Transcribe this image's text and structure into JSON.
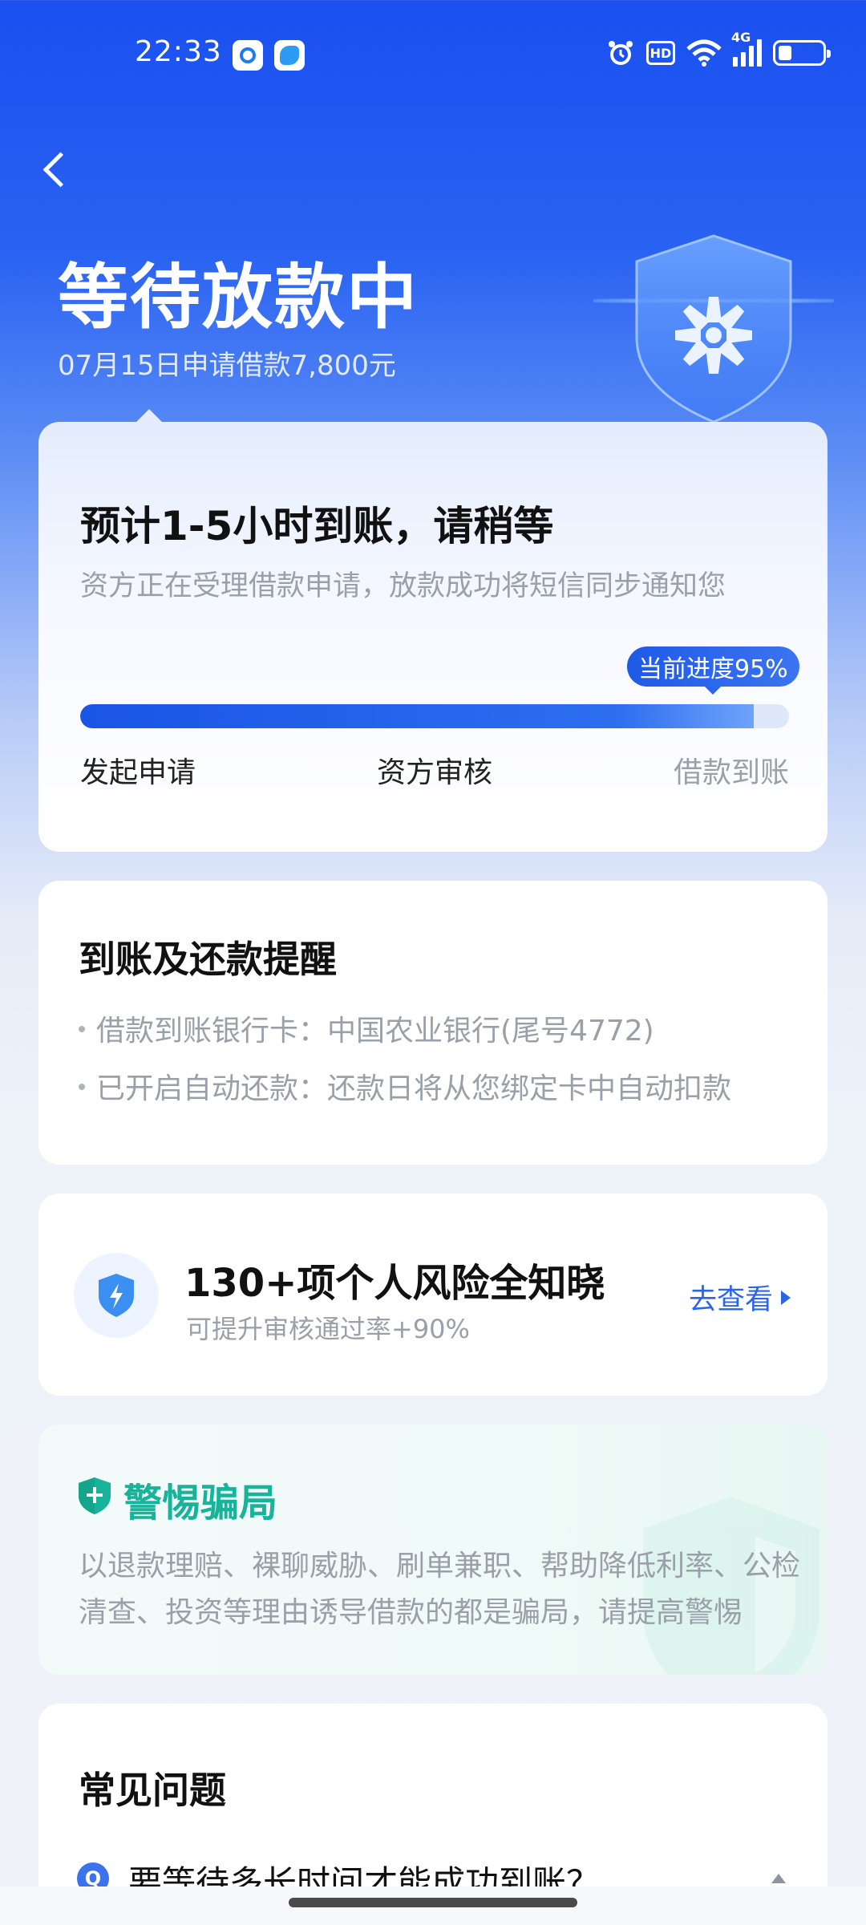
{
  "status_bar": {
    "time": "22:33",
    "icons": [
      "search-app-icon",
      "leaf-app-icon",
      "alarm-icon",
      "hd-icon",
      "wifi-icon",
      "signal-icon",
      "battery-icon"
    ],
    "hd_label": "HD",
    "network_label": "4G"
  },
  "header": {
    "title": "等待放款中",
    "subtitle": "07月15日申请借款7,800元"
  },
  "progress": {
    "title": "预计1-5小时到账，请稍等",
    "description": "资方正在受理借款申请，放款成功将短信同步通知您",
    "badge": "当前进度95%",
    "percent": 95,
    "steps": [
      "发起申请",
      "资方审核",
      "借款到账"
    ]
  },
  "reminder": {
    "title": "到账及还款提醒",
    "lines": [
      "借款到账银行卡：中国农业银行(尾号4772)",
      "已开启自动还款：还款日将从您绑定卡中自动扣款"
    ]
  },
  "risk": {
    "title": "130+项个人风险全知晓",
    "subtitle": "可提升审核通过率+90%",
    "link": "去查看"
  },
  "warning": {
    "title": "警惕骗局",
    "text": "以退款理赔、裸聊威胁、刷单兼职、帮助降低利率、公检清查、投资等理由诱导借款的都是骗局，请提高警惕"
  },
  "faq": {
    "title": "常见问题",
    "badge": "Q",
    "question": "要等待多长时间才能成功到账？"
  },
  "colors": {
    "primary": "#1f5ae8",
    "warning_green": "#17b39a",
    "muted_text": "#9aa0a8"
  }
}
